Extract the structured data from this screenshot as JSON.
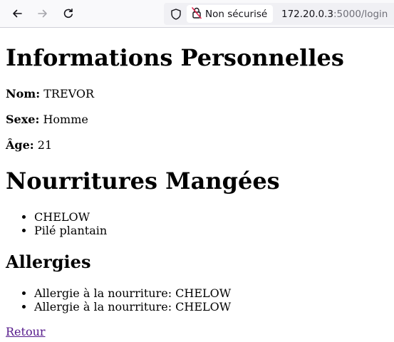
{
  "browser": {
    "security_label": "Non sécurisé",
    "url_host": "172.20.0.3",
    "url_rest": ":5000/login"
  },
  "page": {
    "personal_heading": "Informations Personnelles",
    "name_label": "Nom:",
    "name_value": "TREVOR",
    "sex_label": "Sexe:",
    "sex_value": "Homme",
    "age_label": "Âge:",
    "age_value": "21",
    "foods_heading": "Nourritures Mangées",
    "foods": [
      "CHELOW",
      "Pilé plantain"
    ],
    "allergies_heading": "Allergies",
    "allergies": [
      "Allergie à la nourriture: CHELOW",
      "Allergie à la nourriture: CHELOW"
    ],
    "back_link": "Retour"
  },
  "icons": {
    "back": "arrow-left-icon",
    "forward": "arrow-right-icon",
    "reload": "reload-icon",
    "shield": "shield-icon",
    "insecure": "insecure-lock-icon"
  }
}
